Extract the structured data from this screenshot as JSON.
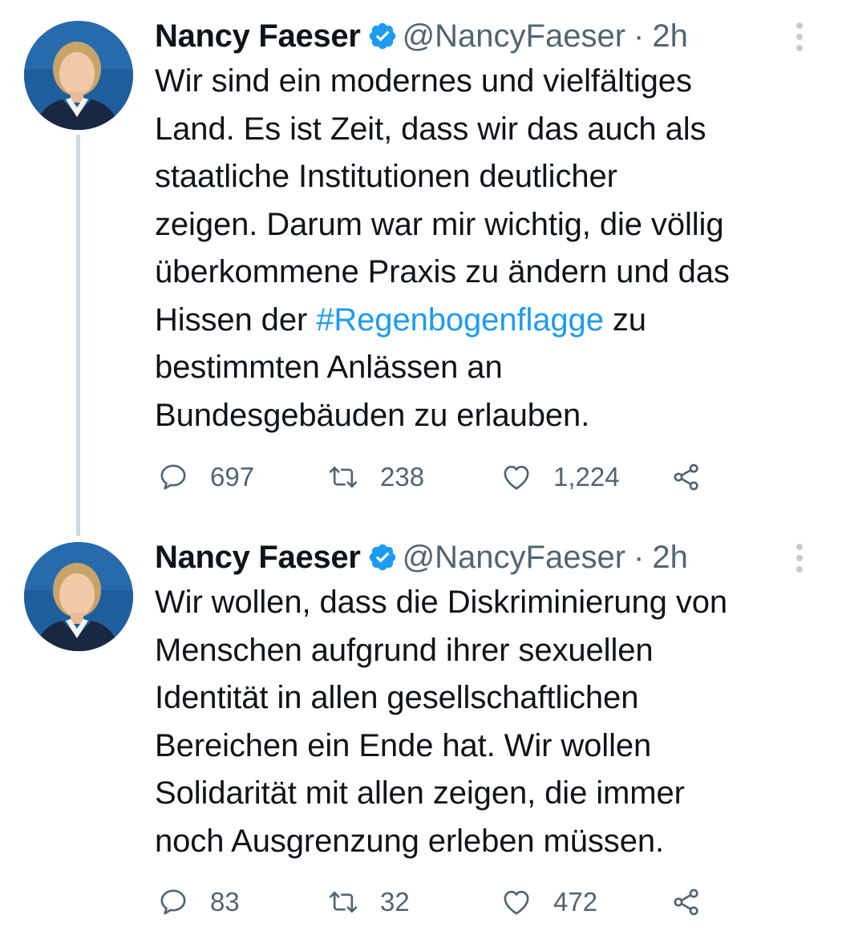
{
  "tweets": [
    {
      "name": "Nancy Faeser",
      "handle": "@NancyFaeser",
      "separator": "·",
      "time": "2h",
      "text_before": "Wir sind ein modernes und vielfältiges\nLand. Es ist Zeit, dass wir das auch als\nstaatliche Institutionen deutlicher\nzeigen. Darum war mir wichtig, die völlig\nüberkommene Praxis zu ändern und das\nHissen der ",
      "hashtag": "#Regenbogenflagge",
      "text_after": " zu\nbestimmten Anlässen an\nBundesgebäuden zu erlauben.",
      "replies": "697",
      "retweets": "238",
      "likes": "1,224"
    },
    {
      "name": "Nancy Faeser",
      "handle": "@NancyFaeser",
      "separator": "·",
      "time": "2h",
      "text": "Wir wollen, dass die Diskriminierung von\nMenschen aufgrund ihrer sexuellen\nIdentität in allen gesellschaftlichen\nBereichen ein Ende hat. Wir wollen\nSolidarität mit allen zeigen, die immer\nnoch Ausgrenzung erleben müssen.",
      "replies": "83",
      "retweets": "32",
      "likes": "472"
    }
  ],
  "colors": {
    "hashtag": "#1d9bf0",
    "verified": "#1d9bf0",
    "secondary_text": "#536471",
    "thread_line": "#cfd9de"
  },
  "icons": [
    "avatar-photo",
    "verified-badge-icon",
    "more-options-icon",
    "reply-icon",
    "retweet-icon",
    "like-icon",
    "share-icon"
  ]
}
